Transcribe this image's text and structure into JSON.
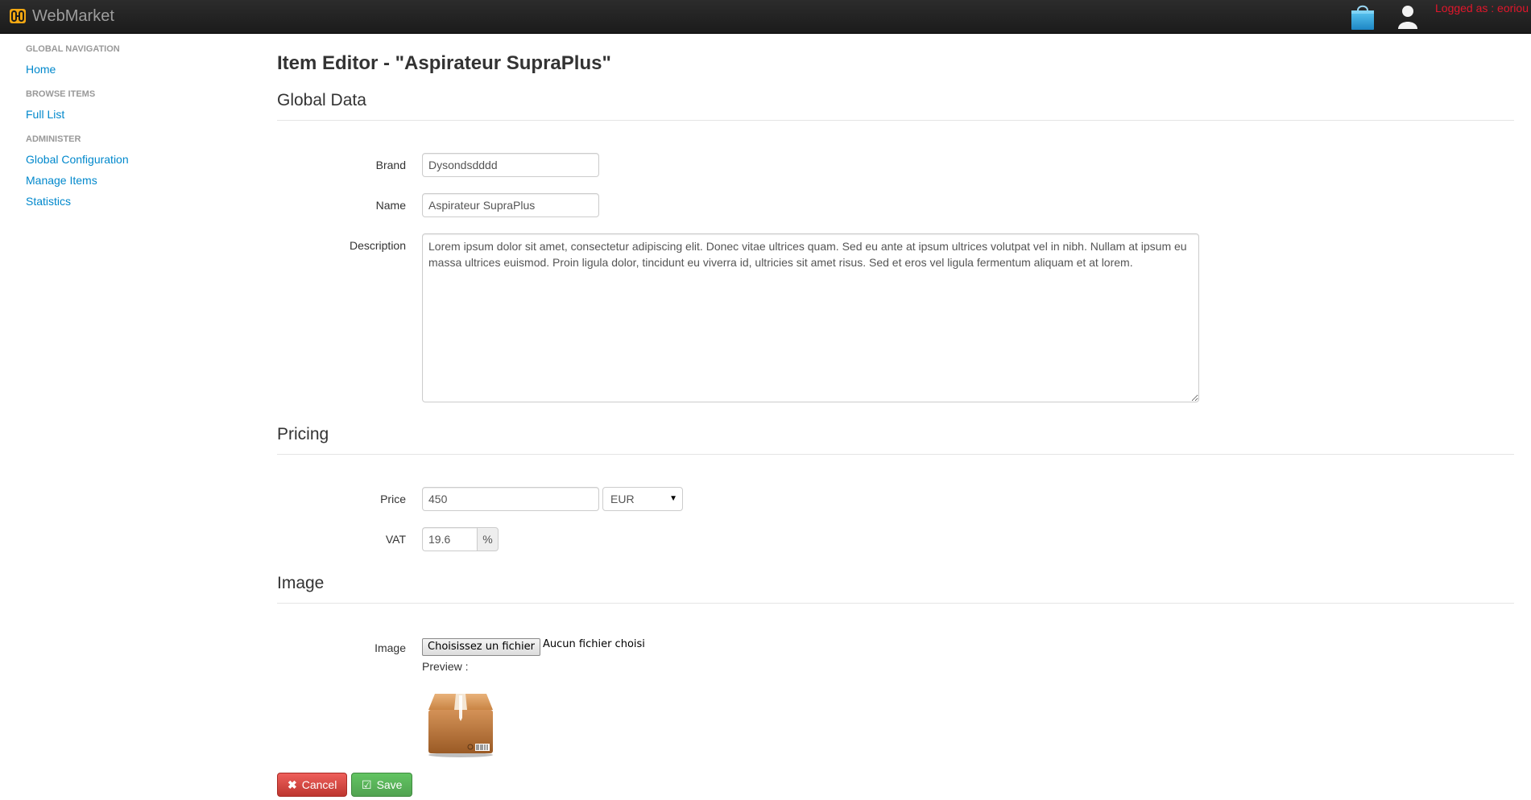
{
  "navbar": {
    "brand": "WebMarket",
    "logged_as": "Logged as : eoriou"
  },
  "sidebar": {
    "groups": [
      {
        "header": "GLOBAL NAVIGATION",
        "items": [
          {
            "label": "Home"
          }
        ]
      },
      {
        "header": "BROWSE ITEMS",
        "items": [
          {
            "label": "Full List"
          }
        ]
      },
      {
        "header": "ADMINISTER",
        "items": [
          {
            "label": "Global Configuration"
          },
          {
            "label": "Manage Items"
          },
          {
            "label": "Statistics"
          }
        ]
      }
    ]
  },
  "main": {
    "title": "Item Editor - \"Aspirateur SupraPlus\"",
    "global_data": {
      "section_title": "Global Data",
      "brand_label": "Brand",
      "brand_value": "Dysondsdddd",
      "name_label": "Name",
      "name_value": "Aspirateur SupraPlus",
      "description_label": "Description",
      "description_value": "Lorem ipsum dolor sit amet, consectetur adipiscing elit. Donec vitae ultrices quam. Sed eu ante at ipsum ultrices volutpat vel in nibh. Nullam at ipsum eu massa ultrices euismod. Proin ligula dolor, tincidunt eu viverra id, ultricies sit amet risus. Sed et eros vel ligula fermentum aliquam et at lorem."
    },
    "pricing": {
      "section_title": "Pricing",
      "price_label": "Price",
      "price_value": "450",
      "currency_selected": "EUR",
      "vat_label": "VAT",
      "vat_value": "19.6",
      "vat_unit": "%"
    },
    "image": {
      "section_title": "Image",
      "image_label": "Image",
      "file_button": "Choisissez un fichier",
      "file_status": "Aucun fichier choisi",
      "preview_label": "Preview :"
    },
    "actions": {
      "cancel_label": "Cancel",
      "save_label": "Save"
    }
  },
  "colors": {
    "navbar_bg": "#1b1b1b",
    "link": "#0088cc",
    "logged_as": "#e2162b",
    "danger": "#da4f49",
    "success": "#5bb75b"
  },
  "icons": [
    "webmarket-logo-icon",
    "shopping-bag-icon",
    "user-icon",
    "times-icon",
    "check-square-icon",
    "package-box-icon"
  ]
}
